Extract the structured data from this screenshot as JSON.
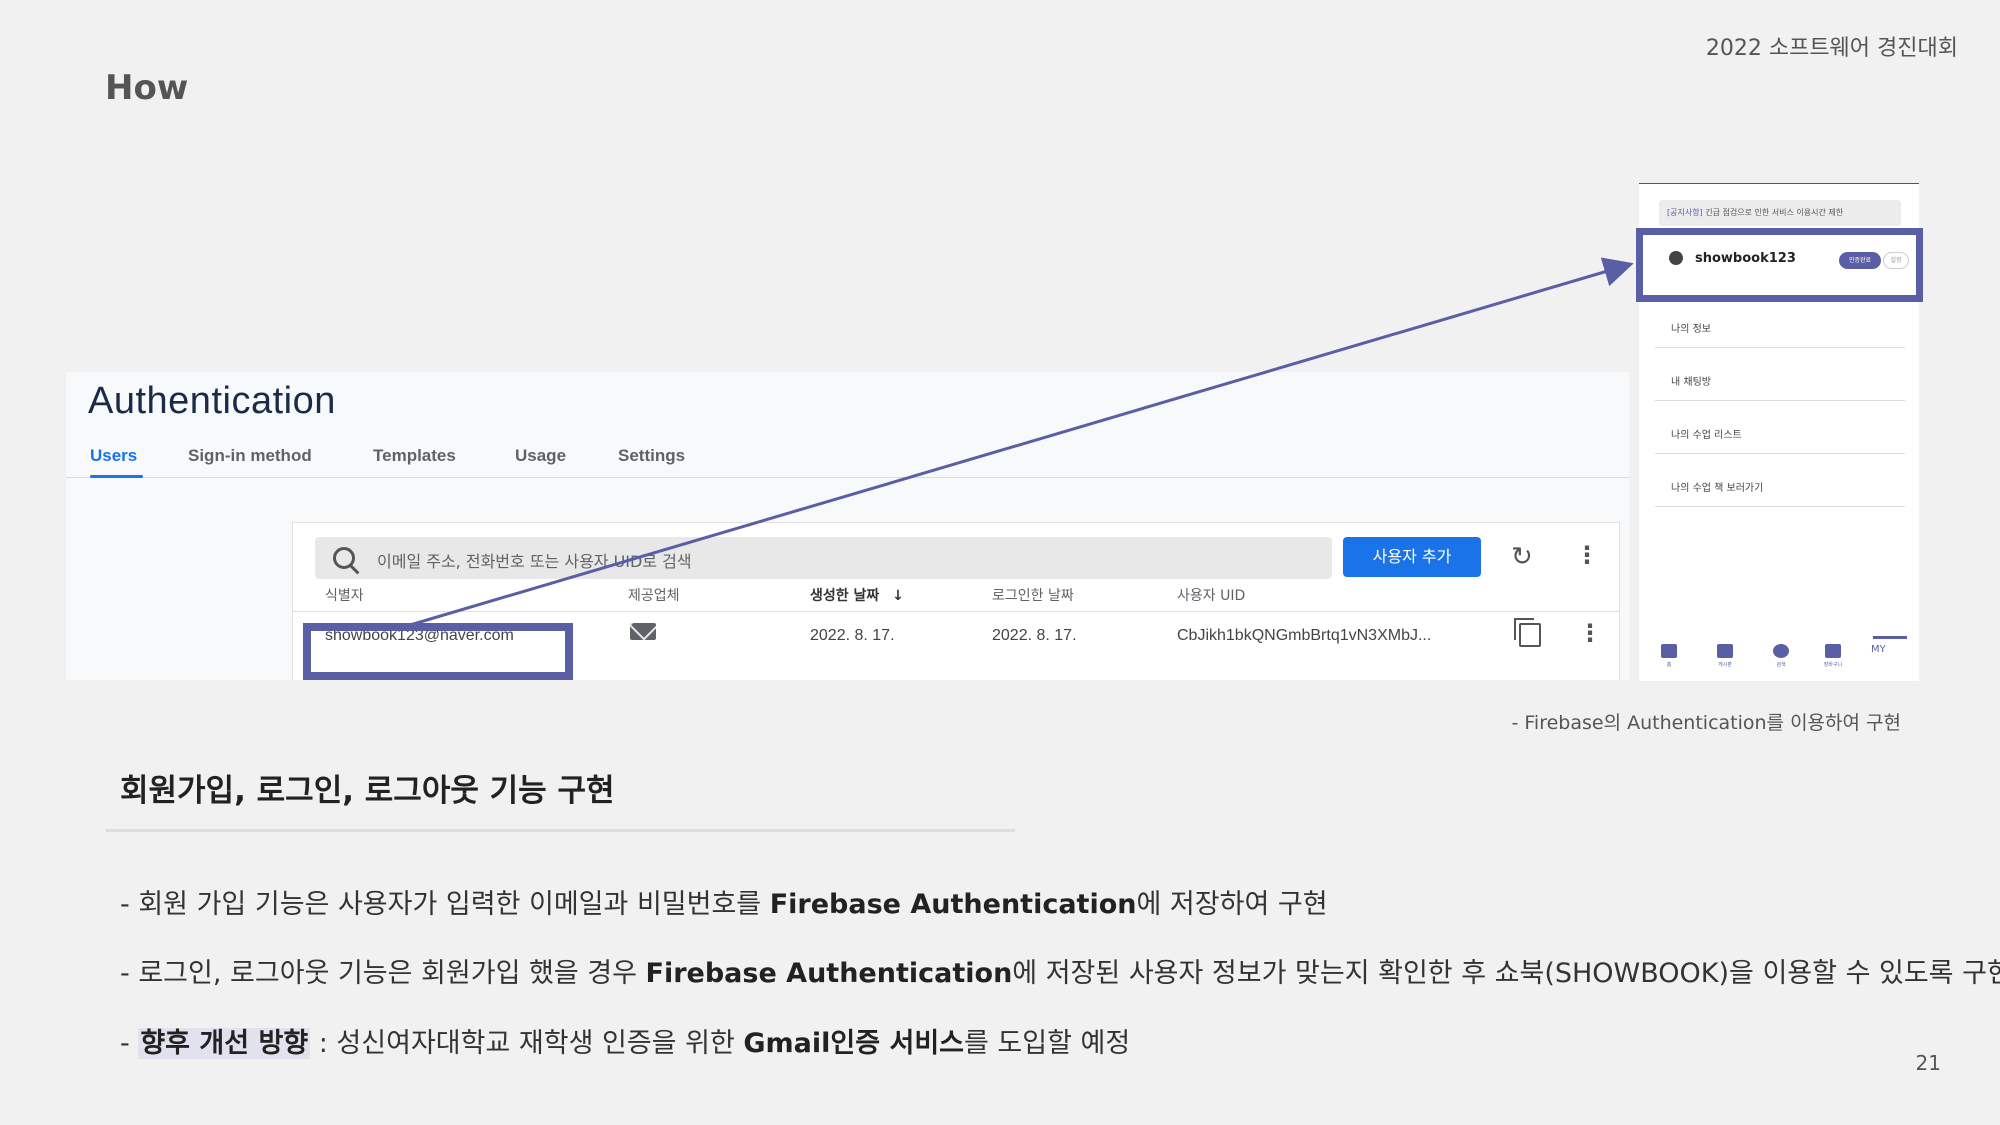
{
  "header": {
    "event": "2022 소프트웨어 경진대회",
    "title": "How"
  },
  "firebase": {
    "title": "Authentication",
    "tabs": [
      "Users",
      "Sign-in method",
      "Templates",
      "Usage",
      "Settings"
    ],
    "search_placeholder": "이메일 주소, 전화번호 또는 사용자 UID로 검색",
    "add_button": "사용자 추가",
    "columns": [
      "식별자",
      "제공업체",
      "생성한 날짜",
      "로그인한 날짜",
      "사용자 UID"
    ],
    "row": {
      "identifier": "showbook123@naver.com",
      "created": "2022. 8. 17.",
      "signed_in": "2022. 8. 17.",
      "uid": "CbJikh1bkQNGmbBrtq1vN3XMbJ..."
    }
  },
  "phone": {
    "notice_tag": "[공지사항]",
    "notice_text": "긴급 점검으로 인한 서비스 이용시간 제한",
    "username": "showbook123",
    "badge_primary": "인증완료",
    "badge_secondary": "설정",
    "menu": [
      "나의 정보",
      "내 채팅방",
      "나의 수업 리스트",
      "나의 수업 책 보러가기"
    ],
    "nav": [
      "홈",
      "게시판",
      "검색",
      "장바구니"
    ],
    "nav_my": "MY"
  },
  "caption": "- Firebase의 Authentication를 이용하여 구현",
  "section": {
    "heading": "회원가입, 로그인, 로그아웃 기능 구현",
    "line1": {
      "a": "- 회원 가입 기능은 사용자가 입력한 이메일과 비밀번호를 ",
      "b": "Firebase Authentication",
      "c": "에 저장하여 구현"
    },
    "line2": {
      "a": "- 로그인, 로그아웃 기능은 회원가입 했을 경우 ",
      "b": "Firebase Authentication",
      "c": "에 저장된 사용자 정보가 맞는지 확인한 후 쇼북(SHOWBOOK)을 이용할 수 있도록 구현"
    },
    "line3": {
      "dash": "- ",
      "mark": "향후 개선 방향",
      "a": " : 성신여자대학교 재학생 인증을 위한 ",
      "b": "Gmail인증 서비스",
      "c": "를 도입할 예정"
    }
  },
  "page_number": "21",
  "colors": {
    "accent": "#5a5fa5",
    "firebase_blue": "#1a73e8"
  }
}
